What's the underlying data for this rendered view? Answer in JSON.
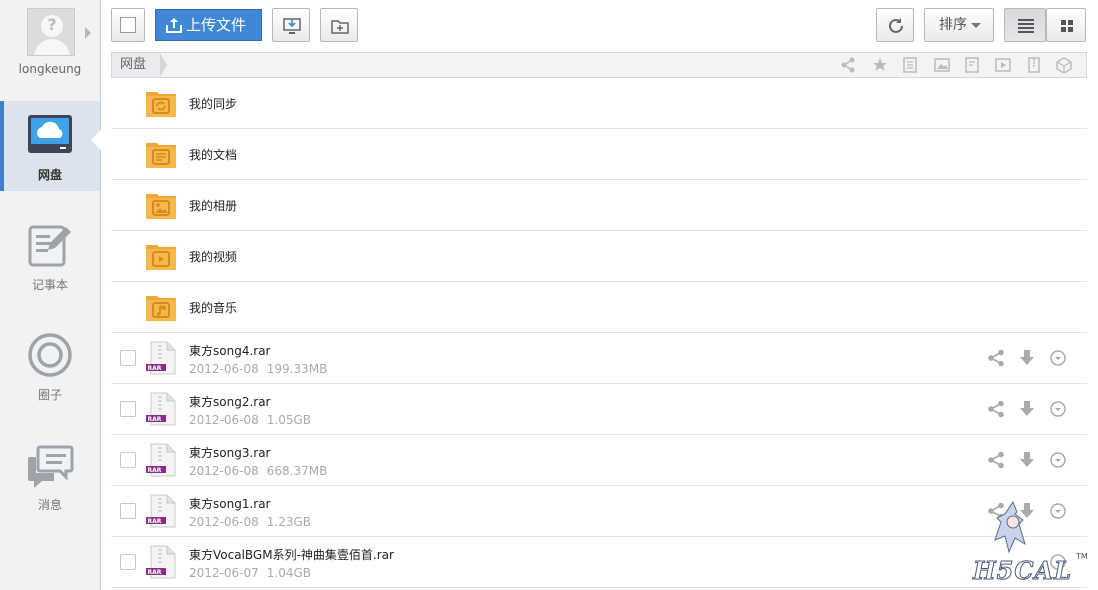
{
  "user": {
    "name": "longkeung"
  },
  "sidebar": {
    "items": [
      {
        "label": "网盘",
        "icon": "cloud-drive-icon",
        "active": true
      },
      {
        "label": "记事本",
        "icon": "notepad-icon",
        "active": false
      },
      {
        "label": "圈子",
        "icon": "circle-icon",
        "active": false
      },
      {
        "label": "消息",
        "icon": "message-icon",
        "active": false
      }
    ]
  },
  "toolbar": {
    "upload_label": "上传文件",
    "sort_label": "排序"
  },
  "breadcrumb": {
    "root": "网盘"
  },
  "folders": [
    {
      "name": "我的同步",
      "icon": "sync-folder-icon"
    },
    {
      "name": "我的文档",
      "icon": "document-folder-icon"
    },
    {
      "name": "我的相册",
      "icon": "photo-folder-icon"
    },
    {
      "name": "我的视频",
      "icon": "video-folder-icon"
    },
    {
      "name": "我的音乐",
      "icon": "music-folder-icon"
    }
  ],
  "files": [
    {
      "name": "東方song4.rar",
      "date": "2012-06-08",
      "size": "199.33MB"
    },
    {
      "name": "東方song2.rar",
      "date": "2012-06-08",
      "size": "1.05GB"
    },
    {
      "name": "東方song3.rar",
      "date": "2012-06-08",
      "size": "668.37MB"
    },
    {
      "name": "東方song1.rar",
      "date": "2012-06-08",
      "size": "1.23GB"
    },
    {
      "name": "東方VocalBGM系列-神曲集壹佰首.rar",
      "date": "2012-06-07",
      "size": "1.04GB"
    }
  ],
  "watermark": {
    "text": "H5CAL",
    "tm": "TM"
  },
  "colors": {
    "accent": "#3f88d6",
    "folder": "#f5b84a",
    "sidebar_bg": "#f1f2f4"
  }
}
